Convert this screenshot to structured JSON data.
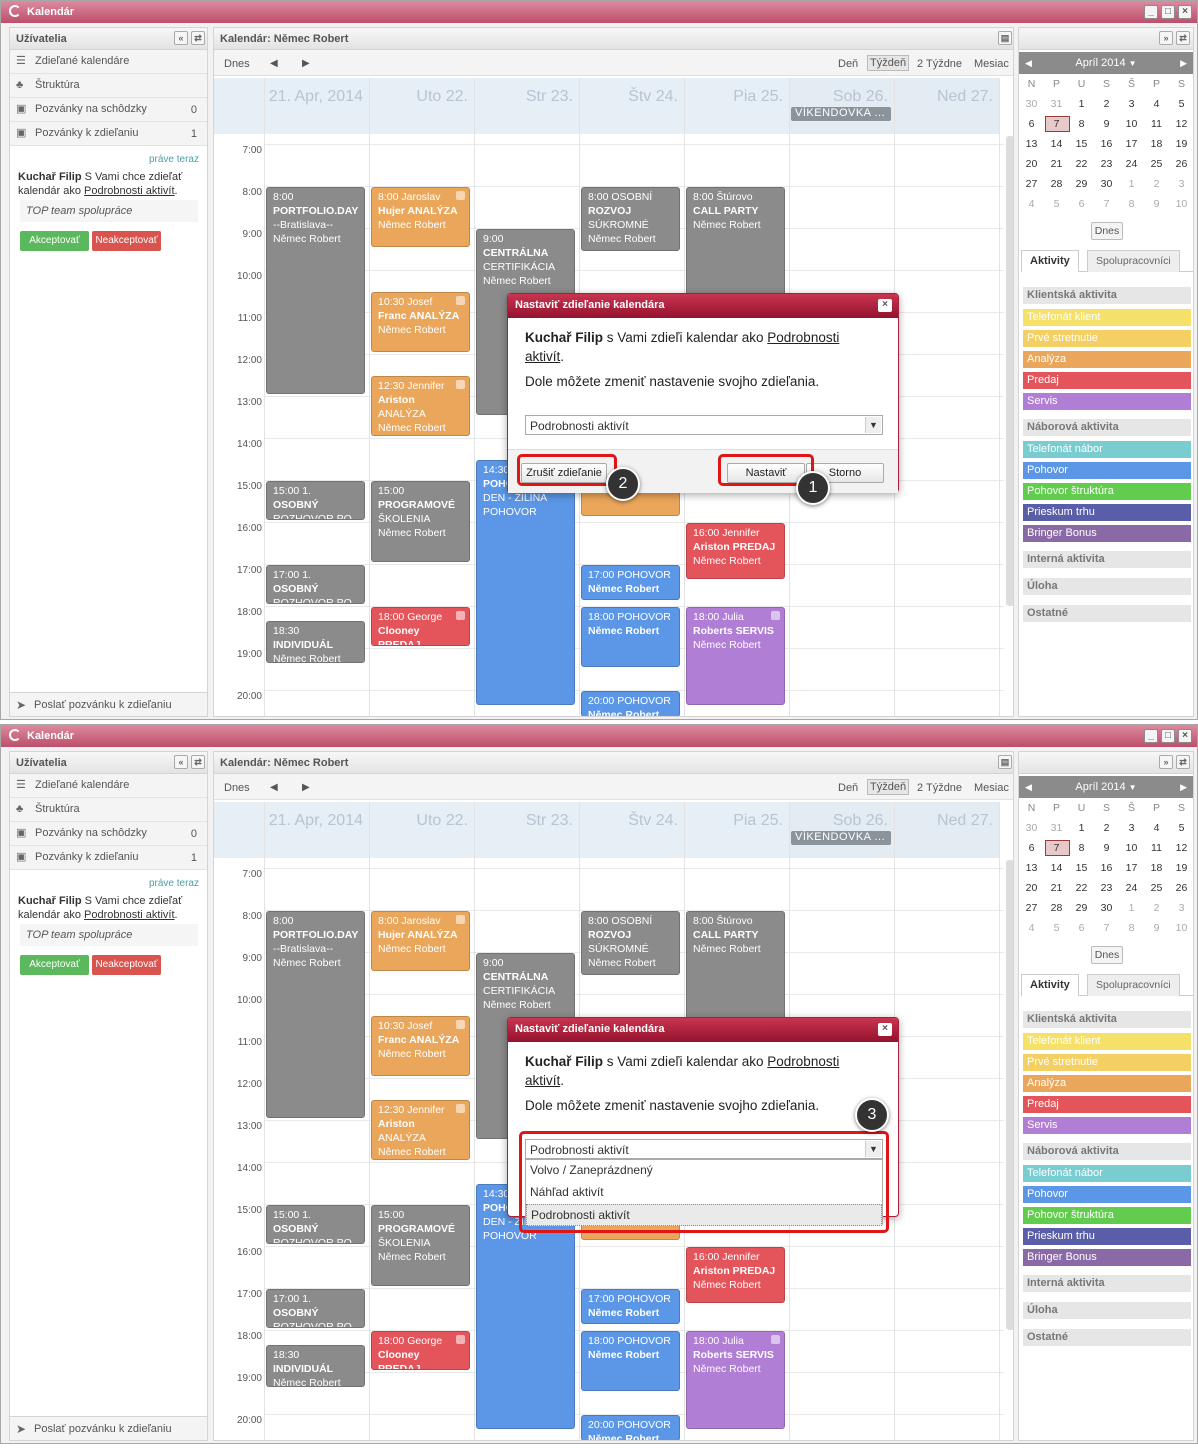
{
  "app_title": "Kalendár",
  "left": {
    "title": "Užívatelia",
    "nav": [
      {
        "label": "Zdieľané kalendáre",
        "count": ""
      },
      {
        "label": "Štruktúra",
        "count": ""
      },
      {
        "label": "Pozvánky na schôdzky",
        "count": "0"
      },
      {
        "label": "Pozvánky k zdieľaniu",
        "count": "1"
      }
    ],
    "invite": {
      "time": "práve teraz",
      "from": "Kuchař Filip",
      "text1": " S Vami chce zdieľať kalendár ako ",
      "link": "Podrobnosti aktivít",
      "text2": ".",
      "team": "TOP team spolupráce",
      "accept": "Akceptovať",
      "reject": "Neakceptovať"
    },
    "footer": "Poslať pozvánku k zdieľaniu"
  },
  "center": {
    "title": "Kalendár: Němec Robert",
    "today": "Dnes",
    "views": [
      "Deň",
      "Týždeň",
      "2 Týždne",
      "Mesiac"
    ],
    "days": [
      "21. Apr, 2014",
      "Uto 22.",
      "Str 23.",
      "Štv 24.",
      "Pia 25.",
      "Sob 26.",
      "Ned 27."
    ],
    "weekend_event": "VÍKENDOVKA ...",
    "hours": [
      "7:00",
      "8:00",
      "9:00",
      "10:00",
      "11:00",
      "12:00",
      "13:00",
      "14:00",
      "15:00",
      "16:00",
      "17:00",
      "18:00",
      "19:00",
      "20:00"
    ]
  },
  "events": [
    {
      "day": 0,
      "start": 8,
      "end": 13,
      "color": "gray",
      "lock": false,
      "l1": "8:00",
      "l2": "PORTFOLIO.DAY",
      "l3": "--Bratislava--",
      "l4": "Němec Robert"
    },
    {
      "day": 0,
      "start": 15,
      "end": 16,
      "color": "gray",
      "lock": false,
      "l1": "15:00   1.",
      "l2": "OSOBNÝ",
      "l3": "ROZHOVOR PO",
      "l4": ""
    },
    {
      "day": 0,
      "start": 17,
      "end": 18,
      "color": "gray",
      "lock": false,
      "l1": "17:00   1.",
      "l2": "OSOBNÝ",
      "l3": "ROZHOVOR PO",
      "l4": ""
    },
    {
      "day": 0,
      "start": 18.33,
      "end": 19.4,
      "color": "gray",
      "lock": false,
      "l1": "18:30",
      "l2": "INDIVIDUÁL",
      "l3": "Němec Robert",
      "l4": ""
    },
    {
      "day": 1,
      "start": 8,
      "end": 9.5,
      "color": "orange",
      "lock": true,
      "l1": "8:00 Jaroslav",
      "l2": "Hujer ANALÝZA",
      "l3": "Němec Robert",
      "l4": ""
    },
    {
      "day": 1,
      "start": 10.5,
      "end": 12,
      "color": "orange",
      "lock": true,
      "l1": "10:30 Josef",
      "l2": "Franc ANALÝZA",
      "l3": "Němec Robert",
      "l4": ""
    },
    {
      "day": 1,
      "start": 12.5,
      "end": 14,
      "color": "orange",
      "lock": true,
      "l1": "12:30 Jennifer",
      "l2": "Ariston",
      "l3": "ANALÝZA",
      "l4": "Němec Robert"
    },
    {
      "day": 1,
      "start": 15,
      "end": 17,
      "color": "gray",
      "lock": false,
      "l1": "15:00",
      "l2": "PROGRAMOVÉ",
      "l3": "ŠKOLENIA",
      "l4": "Němec Robert"
    },
    {
      "day": 1,
      "start": 18,
      "end": 19,
      "color": "red",
      "lock": true,
      "l1": "18:00 George",
      "l2": "Clooney PREDAJ",
      "l3": "Němec Robert",
      "l4": ""
    },
    {
      "day": 2,
      "start": 9,
      "end": 13.5,
      "color": "gray",
      "lock": false,
      "l1": "9:00",
      "l2": "CENTRÁLNA",
      "l3": "CERTIFIKÁCIA",
      "l4": "Němec Robert"
    },
    {
      "day": 2,
      "start": 14.5,
      "end": 20.4,
      "color": "blue",
      "lock": false,
      "l1": "14:30",
      "l2": "POHOVOR",
      "l3": "DEN - ŽILINA",
      "l4": "POHOVOR"
    },
    {
      "day": 3,
      "start": 8,
      "end": 9.6,
      "color": "gray",
      "lock": false,
      "l1": "8:00 OSOBNÍ",
      "l2": "ROZVOJ",
      "l3": "SÚKROMNÉ",
      "l4": "Němec Robert"
    },
    {
      "day": 3,
      "start": 14.6,
      "end": 15.9,
      "color": "orange",
      "lock": false,
      "l1": "ANALÝZA",
      "l2": "Němec Robert",
      "l3": "",
      "l4": ""
    },
    {
      "day": 3,
      "start": 17,
      "end": 17.9,
      "color": "blue",
      "lock": false,
      "l1": "17:00   POHOVOR",
      "l2": "Němec Robert",
      "l3": "",
      "l4": ""
    },
    {
      "day": 3,
      "start": 18,
      "end": 19.5,
      "color": "blue",
      "lock": false,
      "l1": "18:00   POHOVOR",
      "l2": "Němec Robert",
      "l3": "",
      "l4": ""
    },
    {
      "day": 3,
      "start": 20,
      "end": 20.7,
      "color": "blue",
      "lock": false,
      "l1": "20:00   POHOVOR",
      "l2": "Němec Robert",
      "l3": "",
      "l4": ""
    },
    {
      "day": 4,
      "start": 8,
      "end": 14.5,
      "color": "gray",
      "lock": false,
      "l1": "8:00 Štúrovo",
      "l2": "CALL PARTY",
      "l3": "Němec Robert",
      "l4": ""
    },
    {
      "day": 4,
      "start": 16,
      "end": 17.4,
      "color": "red",
      "lock": false,
      "l1": "16:00 Jennifer",
      "l2": "Ariston PREDAJ",
      "l3": "Němec Robert",
      "l4": ""
    },
    {
      "day": 4,
      "start": 18,
      "end": 20.4,
      "color": "purple",
      "lock": true,
      "l1": "18:00 Julia",
      "l2": "Roberts SERVIS",
      "l3": "Němec Robert",
      "l4": ""
    }
  ],
  "mini_cal": {
    "month": "Apríl 2014",
    "weekdays": [
      "N",
      "P",
      "U",
      "S",
      "Š",
      "P",
      "S"
    ],
    "rows": [
      [
        "30",
        "31",
        "1",
        "2",
        "3",
        "4",
        "5"
      ],
      [
        "6",
        "7",
        "8",
        "9",
        "10",
        "11",
        "12"
      ],
      [
        "13",
        "14",
        "15",
        "16",
        "17",
        "18",
        "19"
      ],
      [
        "20",
        "21",
        "22",
        "23",
        "24",
        "25",
        "26"
      ],
      [
        "27",
        "28",
        "29",
        "30",
        "1",
        "2",
        "3"
      ],
      [
        "4",
        "5",
        "6",
        "7",
        "8",
        "9",
        "10"
      ]
    ],
    "today": "Dnes"
  },
  "right_tabs": [
    "Aktivity",
    "Spolupracovníci"
  ],
  "categories": [
    {
      "label": "Klientská aktivita",
      "type": "header",
      "color": ""
    },
    {
      "label": "Telefonát klient",
      "type": "item",
      "color": "#f5e06a"
    },
    {
      "label": "Prvé stretnutie",
      "type": "item",
      "color": "#f4d064"
    },
    {
      "label": "Analýza",
      "type": "item",
      "color": "#eaa65a"
    },
    {
      "label": "Predaj",
      "type": "item",
      "color": "#e4545b"
    },
    {
      "label": "Servis",
      "type": "item",
      "color": "#b07ed4"
    },
    {
      "label": "Náborová aktivita",
      "type": "header",
      "color": ""
    },
    {
      "label": "Telefonát nábor",
      "type": "item",
      "color": "#79ccd0"
    },
    {
      "label": "Pohovor",
      "type": "item",
      "color": "#5b97e6"
    },
    {
      "label": "Pohovor štruktúra",
      "type": "item",
      "color": "#62cc4e"
    },
    {
      "label": "Prieskum trhu",
      "type": "item",
      "color": "#5a5ea8"
    },
    {
      "label": "Bringer Bonus",
      "type": "item",
      "color": "#8a6aa6"
    },
    {
      "label": "Interná aktivita",
      "type": "header",
      "color": ""
    },
    {
      "label": "Úloha",
      "type": "header",
      "color": ""
    },
    {
      "label": "Ostatné",
      "type": "header",
      "color": ""
    }
  ],
  "dialog": {
    "title": "Nastaviť zdieľanie kalendára",
    "user": "Kuchař Filip",
    "msg1": " s Vami zdieľi kalendar ako ",
    "link": "Podrobnosti aktivít",
    "msg2": ".",
    "msg3": "Dole môžete zmeniť nastavenie svojho zdieľania.",
    "select_value": "Podrobnosti aktivít",
    "options": [
      "Volvo / Zaneprázdnený",
      "Náhľad aktivít",
      "Podrobnosti aktivít"
    ],
    "btn_cancel_share": "Zrušiť zdieľanie",
    "btn_set": "Nastaviť",
    "btn_storno": "Storno"
  },
  "callouts": [
    "1",
    "2",
    "3"
  ]
}
